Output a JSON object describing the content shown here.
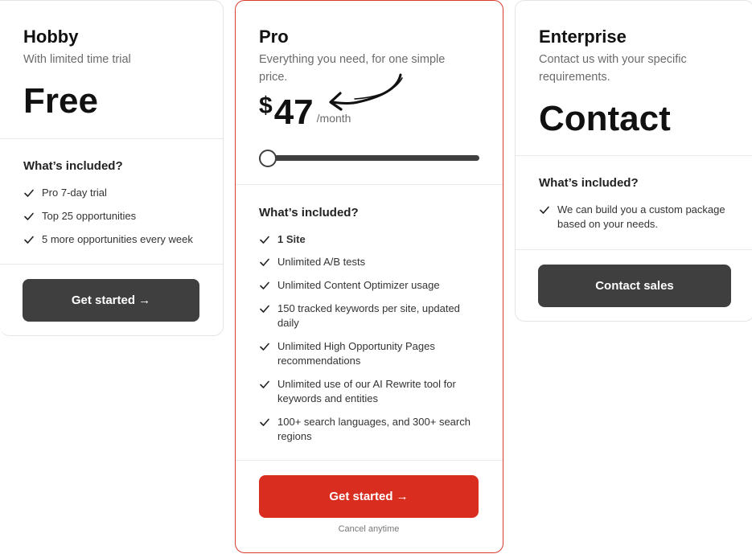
{
  "plans": {
    "hobby": {
      "name": "Hobby",
      "description": "With limited time trial",
      "price": "Free",
      "included_title": "What’s included?",
      "features": [
        "Pro 7-day trial",
        "Top 25 opportunities",
        "5 more opportunities every week"
      ],
      "cta": "Get started →"
    },
    "pro": {
      "name": "Pro",
      "description": "Everything you need, for one simple price.",
      "currency": "$",
      "price": "47",
      "period": "/month",
      "slider_level": 0,
      "included_title": "What’s included?",
      "features": [
        "1 Site",
        "Unlimited A/B tests",
        "Unlimited Content Optimizer usage",
        "150 tracked keywords per site, updated daily",
        "Unlimited High Opportunity Pages recommendations",
        "Unlimited use of our AI Rewrite tool for keywords and entities",
        "100+ search languages, and 300+ search regions"
      ],
      "cta": "Get started →",
      "footnote": "Cancel anytime"
    },
    "enterprise": {
      "name": "Enterprise",
      "description": "Contact us with your specific requirements.",
      "price": "Contact",
      "included_title": "What’s included?",
      "features": [
        "We can build you a custom package based on your needs."
      ],
      "cta": "Contact sales"
    }
  },
  "colors": {
    "accent": "#d92d20",
    "button_dark": "#3f3f3f",
    "muted_text": "#6b6b6b"
  }
}
